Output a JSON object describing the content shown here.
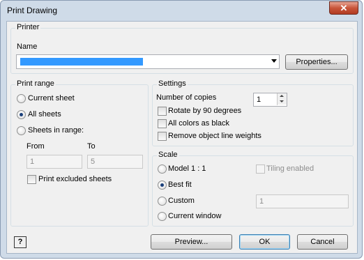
{
  "window": {
    "title": "Print Drawing",
    "close_glyph": "✕"
  },
  "printer": {
    "group_label": "Printer",
    "name_label": "Name",
    "properties_button": "Properties..."
  },
  "print_range": {
    "group_label": "Print range",
    "current_sheet": "Current sheet",
    "all_sheets": "All sheets",
    "sheets_in_range": "Sheets in range:",
    "from_label": "From",
    "to_label": "To",
    "from_value": "1",
    "to_value": "5",
    "print_excluded": "Print excluded sheets",
    "selected": "all_sheets"
  },
  "settings": {
    "group_label": "Settings",
    "copies_label": "Number of copies",
    "copies_value": "1",
    "rotate": "Rotate by 90 degrees",
    "all_colors_black": "All colors as black",
    "remove_line_weights": "Remove object line weights"
  },
  "scale": {
    "group_label": "Scale",
    "model": "Model 1 : 1",
    "tiling": "Tiling enabled",
    "best_fit": "Best fit",
    "custom": "Custom",
    "custom_value": "1",
    "current_window": "Current window",
    "selected": "best_fit"
  },
  "footer": {
    "help_glyph": "?",
    "preview": "Preview...",
    "ok": "OK",
    "cancel": "Cancel"
  },
  "colors": {
    "selection": "#3399ff",
    "frame": "#cfdbe8"
  }
}
